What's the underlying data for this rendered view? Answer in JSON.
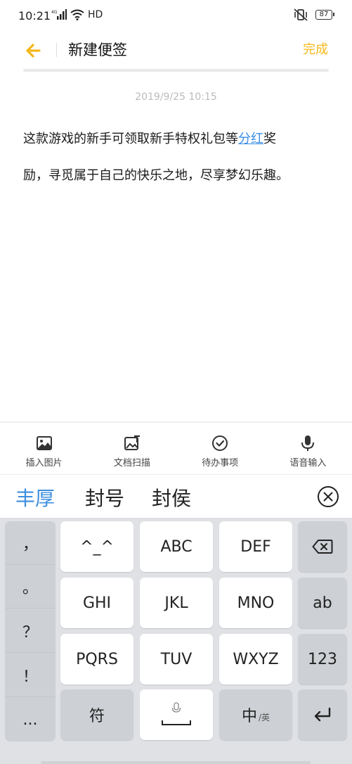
{
  "status": {
    "time": "10:21",
    "network": "4G",
    "hd": "HD",
    "battery": "87"
  },
  "header": {
    "title": "新建便签",
    "done": "完成"
  },
  "note": {
    "date": "2019/9/25 10:15",
    "line1_before": "这款游戏的新手可领取新手特权礼包等",
    "link": "分红",
    "line1_after": "奖",
    "line2": "励，寻觅属于自己的快乐之地，尽享梦幻乐趣。"
  },
  "toolbar": [
    {
      "label": "插入图片",
      "icon": "image-icon"
    },
    {
      "label": "文档扫描",
      "icon": "scan-icon"
    },
    {
      "label": "待办事项",
      "icon": "check-circle-icon"
    },
    {
      "label": "语音输入",
      "icon": "microphone-icon"
    }
  ],
  "candidates": [
    "丰厚",
    "封号",
    "封侯"
  ],
  "keyboard": {
    "punctuation": [
      "，",
      "。",
      "？",
      "！",
      "..."
    ],
    "keys": [
      "^_^",
      "ABC",
      "DEF",
      "GHI",
      "JKL",
      "MNO",
      "PQRS",
      "TUV",
      "WXYZ"
    ],
    "ab": "ab",
    "num": "123",
    "symbol": "符",
    "zh": "中",
    "en": "/英"
  },
  "colors": {
    "accent": "#f5b81a",
    "link": "#3a8ee6",
    "candidate_selected": "#3c8fe0"
  }
}
